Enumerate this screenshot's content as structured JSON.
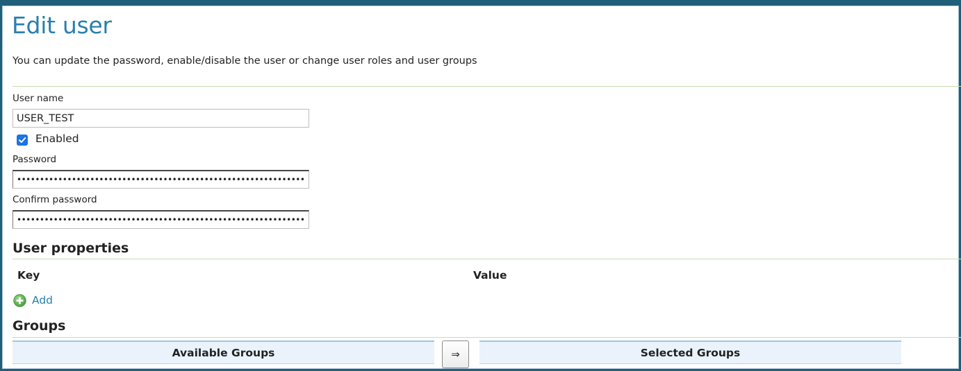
{
  "header": {
    "title": "Edit user",
    "subtitle": "You can update the password, enable/disable the user or change user roles and user groups"
  },
  "form": {
    "username_label": "User name",
    "username_value": "USER_TEST",
    "enabled_label": "Enabled",
    "enabled_checked": true,
    "password_label": "Password",
    "password_value": "••••••••••••••••••••••••••••••••••••••••••••••••••••••••••••••••••••••••••",
    "confirm_password_label": "Confirm password",
    "confirm_password_value": "••••••••••••••••••••••••••••••••••••••••••••••••••••••••••••••••••••••••••"
  },
  "user_properties": {
    "heading": "User properties",
    "columns": [
      "Key",
      "Value"
    ],
    "add_label": "Add",
    "add_icon": "add-circle-icon"
  },
  "groups": {
    "heading": "Groups",
    "available_label": "Available Groups",
    "move_button_label": "⇒",
    "selected_label": "Selected Groups"
  },
  "colors": {
    "title": "#2a7fae",
    "frame": "#1f5f79",
    "rule": "#c9dcb0",
    "add_icon": "#5cb85c",
    "groups_header_bg": "#eaf3fb",
    "checkbox": "#1a73e8"
  }
}
